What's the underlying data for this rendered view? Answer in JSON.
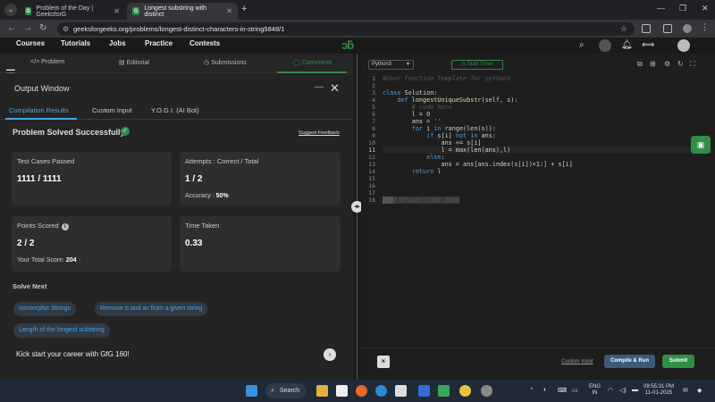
{
  "browser": {
    "tabs": [
      {
        "title": "Problem of the Day | GeeksforG"
      },
      {
        "title": "Longest substring with distinct"
      }
    ],
    "url": "geeksforgeeks.org/problems/longest-distinct-characters-in-string5848/1"
  },
  "site_nav": {
    "items": [
      "Courses",
      "Tutorials",
      "Jobs",
      "Practice",
      "Contests"
    ],
    "logo": "GfG"
  },
  "problem_tabs": {
    "problem": "Problem",
    "editorial": "Editorial",
    "submissions": "Submissions",
    "comments": "Comments"
  },
  "output": {
    "title": "Output Window",
    "tabs": {
      "compile": "Compilation Results",
      "custom": "Custom Input",
      "yogi": "Y.O.G.I. (AI Bot)"
    },
    "status": "Problem Solved Successfully",
    "suggest_feedback": "Suggest Feedback",
    "cards": {
      "tests_label": "Test Cases Passed",
      "tests_value": "1111 / 1111",
      "attempts_label": "Attempts : Correct / Total",
      "attempts_value": "1 / 2",
      "accuracy_label": "Accuracy :",
      "accuracy_value": "50%",
      "points_label": "Points Scored",
      "points_value": "2 / 2",
      "total_score_label": "Your Total Score:",
      "total_score_value": "204",
      "time_label": "Time Taken",
      "time_value": "0.33"
    },
    "solve_next_title": "Solve Next",
    "solve_next": [
      "Isomorphic Strings",
      "Remove b and ac from a given string",
      "Length of the longest substring"
    ],
    "kickstart": "Kick start your career with GfG 160!"
  },
  "editor": {
    "language": "Python3",
    "start_timer": "Start Timer",
    "line_numbers": [
      "1",
      "2",
      "3",
      "4",
      "5",
      "6",
      "7",
      "8",
      "9",
      "10",
      "11",
      "12",
      "13",
      "14",
      "15",
      "16",
      "17",
      "18"
    ],
    "code": {
      "l1": "#User function Template for python3",
      "l3_kw": "class",
      "l3_rest": " Solution:",
      "l4_kw": "def",
      "l4_fn": "longestUniqueSubstr",
      "l4_params_self": "self",
      "l4_params_rest": ", s):",
      "l5": "# code here",
      "l6": "l = ",
      "l6_num": "0",
      "l7": "ans = ",
      "l7_str": "''",
      "l8_kw1": "for",
      "l8_mid": " i ",
      "l8_kw2": "in",
      "l8_rest": " range(len(s)):",
      "l9_kw": "if",
      "l9_mid": " s[i] ",
      "l9_kw2": "not in",
      "l9_rest": " ans:",
      "l10": "ans += s[i]",
      "l11": "l = max(len(ans),l)",
      "l12_kw": "else",
      "l12_rest": ":",
      "l13": "ans = ans[ans.index(s[i])+1:] + s[i]",
      "l14_kw": "return",
      "l14_rest": " l",
      "l18": "} Driver Code Ends"
    },
    "custom_input": "Custom Input",
    "compile_run": "Compile & Run",
    "submit": "Submit"
  },
  "taskbar": {
    "search": "Search",
    "lang_top": "ENG",
    "lang_bottom": "IN",
    "time": "09:55:31 PM",
    "date": "11-01-2025"
  }
}
